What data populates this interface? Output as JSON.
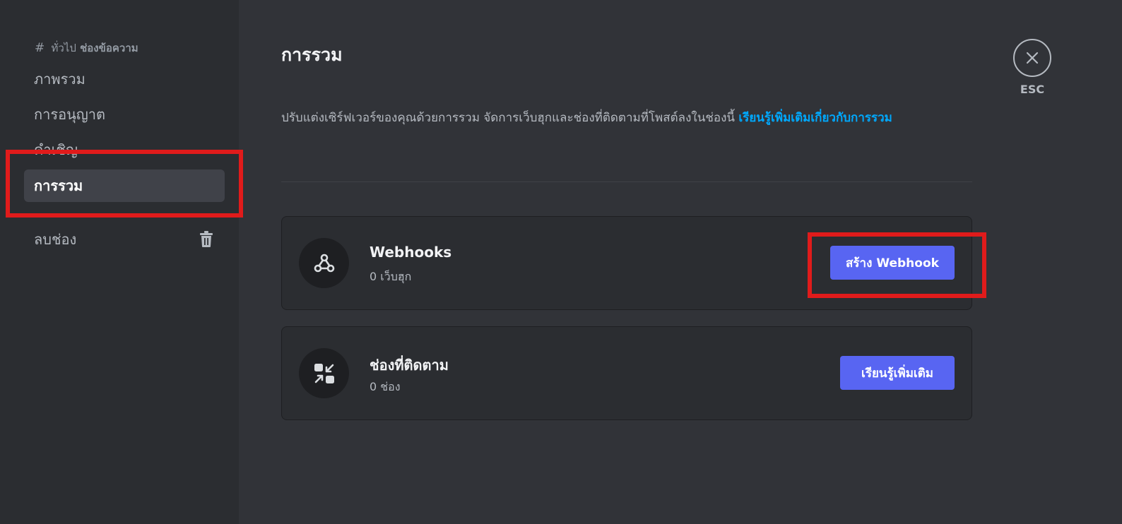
{
  "sidebar": {
    "header_hash": "#",
    "header_channel": "ทั่วไป",
    "header_type": "ช่องข้อความ",
    "items": [
      {
        "label": "ภาพรวม"
      },
      {
        "label": "การอนุญาต"
      },
      {
        "label": "คำเชิญ"
      },
      {
        "label": "การรวม"
      }
    ],
    "delete_label": "ลบช่อง"
  },
  "main": {
    "title": "การรวม",
    "description": "ปรับแต่งเซิร์ฟเวอร์ของคุณด้วยการรวม จัดการเว็บฮุกและช่องที่ติดตามที่โพสต์ลงในช่องนี้ ",
    "learn_more_link": "เรียนรู้เพิ่มเติมเกี่ยวกับการรวม",
    "cards": [
      {
        "title": "Webhooks",
        "subtitle": "0 เว็บฮุก",
        "button": "สร้าง Webhook",
        "icon": "webhook-icon"
      },
      {
        "title": "ช่องที่ติดตาม",
        "subtitle": "0 ช่อง",
        "button": "เรียนรู้เพิ่มเติม",
        "icon": "follow-icon"
      }
    ]
  },
  "close": {
    "esc_label": "ESC"
  },
  "colors": {
    "accent": "#5865f2",
    "link": "#00a8fc",
    "highlight": "#e01b1b",
    "background": "#313338",
    "sidebar": "#2b2d31"
  }
}
